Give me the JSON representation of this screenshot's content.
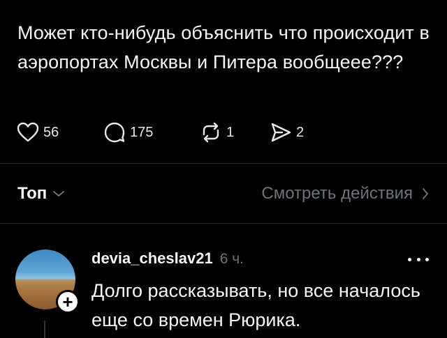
{
  "post": {
    "text": "Может кто-нибудь объяснить что происходит в аэропортах Москвы и Питера вообщеее???",
    "actions": {
      "likes": "56",
      "comments": "175",
      "reposts": "1",
      "shares": "2"
    }
  },
  "replies_header": {
    "sort_label": "Топ",
    "view_activity_label": "Смотреть действия"
  },
  "comment": {
    "username": "devia_cheslav21",
    "time": "6 ч.",
    "text": "Долго рассказывать, но все началось еще со времен Рюрика."
  },
  "colors": {
    "background": "#000000",
    "text": "#f3f5f7",
    "muted": "#6f7377",
    "divider": "#2a2a2a"
  },
  "icons": [
    "heart-icon",
    "comment-icon",
    "repost-icon",
    "share-icon",
    "chevron-down-icon",
    "chevron-right-icon",
    "more-icon",
    "plus-icon"
  ]
}
